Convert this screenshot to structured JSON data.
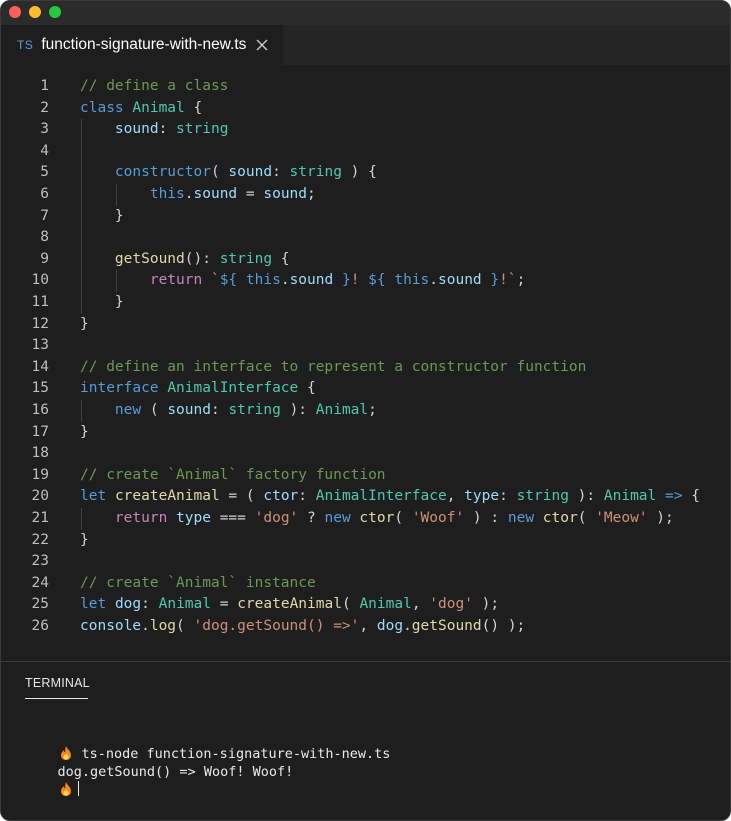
{
  "window": {
    "title": ""
  },
  "tab": {
    "icon_text": "TS",
    "filename": "function-signature-with-new.ts",
    "close_icon": "close-icon"
  },
  "editor": {
    "lines": [
      [
        [
          "c-com",
          "// define a class"
        ]
      ],
      [
        [
          "c-kw",
          "class"
        ],
        [
          "c-p",
          " "
        ],
        [
          "c-type",
          "Animal"
        ],
        [
          "c-p",
          " {"
        ]
      ],
      [
        [
          "c-p",
          "    "
        ],
        [
          "c-var",
          "sound"
        ],
        [
          "c-p",
          ": "
        ],
        [
          "c-type",
          "string"
        ]
      ],
      [],
      [
        [
          "c-p",
          "    "
        ],
        [
          "c-kw",
          "constructor"
        ],
        [
          "c-p",
          "( "
        ],
        [
          "c-var",
          "sound"
        ],
        [
          "c-p",
          ": "
        ],
        [
          "c-type",
          "string"
        ],
        [
          "c-p",
          " ) {"
        ]
      ],
      [
        [
          "c-p",
          "        "
        ],
        [
          "c-kw",
          "this"
        ],
        [
          "c-p",
          "."
        ],
        [
          "c-var",
          "sound"
        ],
        [
          "c-p",
          " = "
        ],
        [
          "c-var",
          "sound"
        ],
        [
          "c-p",
          ";"
        ]
      ],
      [
        [
          "c-p",
          "    }"
        ]
      ],
      [],
      [
        [
          "c-p",
          "    "
        ],
        [
          "c-fn",
          "getSound"
        ],
        [
          "c-p",
          "(): "
        ],
        [
          "c-type",
          "string"
        ],
        [
          "c-p",
          " {"
        ]
      ],
      [
        [
          "c-p",
          "        "
        ],
        [
          "c-ctl",
          "return"
        ],
        [
          "c-p",
          " "
        ],
        [
          "c-str",
          "`"
        ],
        [
          "c-kw",
          "${"
        ],
        [
          "c-p",
          " "
        ],
        [
          "c-kw",
          "this"
        ],
        [
          "c-p",
          "."
        ],
        [
          "c-var",
          "sound"
        ],
        [
          "c-p",
          " "
        ],
        [
          "c-kw",
          "}"
        ],
        [
          "c-str",
          "! "
        ],
        [
          "c-kw",
          "${"
        ],
        [
          "c-p",
          " "
        ],
        [
          "c-kw",
          "this"
        ],
        [
          "c-p",
          "."
        ],
        [
          "c-var",
          "sound"
        ],
        [
          "c-p",
          " "
        ],
        [
          "c-kw",
          "}"
        ],
        [
          "c-str",
          "!`"
        ],
        [
          "c-p",
          ";"
        ]
      ],
      [
        [
          "c-p",
          "    }"
        ]
      ],
      [
        [
          "c-p",
          "}"
        ]
      ],
      [],
      [
        [
          "c-com",
          "// define an interface to represent a constructor function"
        ]
      ],
      [
        [
          "c-kw",
          "interface"
        ],
        [
          "c-p",
          " "
        ],
        [
          "c-type",
          "AnimalInterface"
        ],
        [
          "c-p",
          " {"
        ]
      ],
      [
        [
          "c-p",
          "    "
        ],
        [
          "c-kw",
          "new"
        ],
        [
          "c-p",
          " ( "
        ],
        [
          "c-var",
          "sound"
        ],
        [
          "c-p",
          ": "
        ],
        [
          "c-type",
          "string"
        ],
        [
          "c-p",
          " ): "
        ],
        [
          "c-type",
          "Animal"
        ],
        [
          "c-p",
          ";"
        ]
      ],
      [
        [
          "c-p",
          "}"
        ]
      ],
      [],
      [
        [
          "c-com",
          "// create `Animal` factory function"
        ]
      ],
      [
        [
          "c-kw",
          "let"
        ],
        [
          "c-p",
          " "
        ],
        [
          "c-fn",
          "createAnimal"
        ],
        [
          "c-p",
          " = ( "
        ],
        [
          "c-var",
          "ctor"
        ],
        [
          "c-p",
          ": "
        ],
        [
          "c-type",
          "AnimalInterface"
        ],
        [
          "c-p",
          ", "
        ],
        [
          "c-var",
          "type"
        ],
        [
          "c-p",
          ": "
        ],
        [
          "c-type",
          "string"
        ],
        [
          "c-p",
          " ): "
        ],
        [
          "c-type",
          "Animal"
        ],
        [
          "c-p",
          " "
        ],
        [
          "c-kw",
          "=>"
        ],
        [
          "c-p",
          " {"
        ]
      ],
      [
        [
          "c-p",
          "    "
        ],
        [
          "c-ctl",
          "return"
        ],
        [
          "c-p",
          " "
        ],
        [
          "c-var",
          "type"
        ],
        [
          "c-p",
          " === "
        ],
        [
          "c-str",
          "'dog'"
        ],
        [
          "c-p",
          " ? "
        ],
        [
          "c-kw",
          "new"
        ],
        [
          "c-p",
          " "
        ],
        [
          "c-fn",
          "ctor"
        ],
        [
          "c-p",
          "( "
        ],
        [
          "c-str",
          "'Woof'"
        ],
        [
          "c-p",
          " ) : "
        ],
        [
          "c-kw",
          "new"
        ],
        [
          "c-p",
          " "
        ],
        [
          "c-fn",
          "ctor"
        ],
        [
          "c-p",
          "( "
        ],
        [
          "c-str",
          "'Meow'"
        ],
        [
          "c-p",
          " );"
        ]
      ],
      [
        [
          "c-p",
          "}"
        ]
      ],
      [],
      [
        [
          "c-com",
          "// create `Animal` instance"
        ]
      ],
      [
        [
          "c-kw",
          "let"
        ],
        [
          "c-p",
          " "
        ],
        [
          "c-var",
          "dog"
        ],
        [
          "c-p",
          ": "
        ],
        [
          "c-type",
          "Animal"
        ],
        [
          "c-p",
          " = "
        ],
        [
          "c-fn",
          "createAnimal"
        ],
        [
          "c-p",
          "( "
        ],
        [
          "c-type",
          "Animal"
        ],
        [
          "c-p",
          ", "
        ],
        [
          "c-str",
          "'dog'"
        ],
        [
          "c-p",
          " );"
        ]
      ],
      [
        [
          "c-var",
          "console"
        ],
        [
          "c-p",
          "."
        ],
        [
          "c-fn",
          "log"
        ],
        [
          "c-p",
          "( "
        ],
        [
          "c-str",
          "'dog.getSound() =>'"
        ],
        [
          "c-p",
          ", "
        ],
        [
          "c-var",
          "dog"
        ],
        [
          "c-p",
          "."
        ],
        [
          "c-fn",
          "getSound"
        ],
        [
          "c-p",
          "() );"
        ]
      ]
    ]
  },
  "panel": {
    "tab_label": "TERMINAL",
    "terminal": {
      "command": "ts-node function-signature-with-new.ts",
      "output": "dog.getSound() => Woof! Woof!",
      "prompt_icon": "flame-icon"
    }
  }
}
